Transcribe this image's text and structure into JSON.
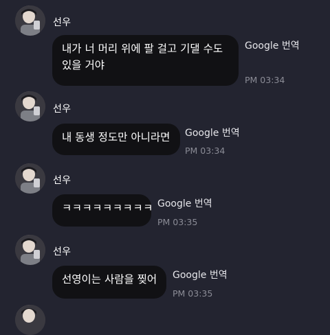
{
  "messages": [
    {
      "sender": "선우",
      "lines": [
        "내가 너 머리 위에 팔 걸고 기댈 수도",
        "있을 거야"
      ],
      "translate_label": "Google 번역",
      "time": "PM 03:34"
    },
    {
      "sender": "선우",
      "lines": [
        "내 동생 정도만 아니라면"
      ],
      "translate_label": "Google 번역",
      "time": "PM 03:34"
    },
    {
      "sender": "선우",
      "lines": [
        "ㅋㅋㅋㅋㅋㅋㅋㅋㅋ"
      ],
      "translate_label": "Google 번역",
      "time": "PM 03:35"
    },
    {
      "sender": "선우",
      "lines": [
        "선영이는 사람을 찢어"
      ],
      "translate_label": "Google 번역",
      "time": "PM 03:35"
    }
  ],
  "colors": {
    "background": "#232430",
    "bubble": "#111114",
    "time": "#8b8c96"
  }
}
